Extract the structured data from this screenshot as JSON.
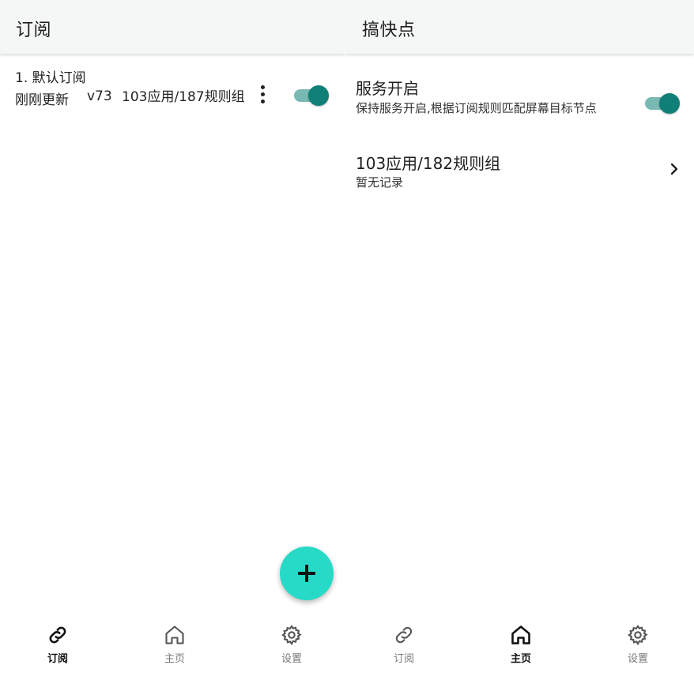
{
  "left": {
    "title": "订阅",
    "subscription": {
      "name": "1. 默认订阅",
      "updated": "刚刚更新",
      "version": "v73",
      "stats": "103应用/187规则组",
      "enabled": true
    },
    "fab_icon": "plus-icon",
    "nav": [
      {
        "label": "订阅",
        "icon": "link-icon",
        "active": true
      },
      {
        "label": "主页",
        "icon": "home-icon",
        "active": false
      },
      {
        "label": "设置",
        "icon": "gear-icon",
        "active": false
      }
    ]
  },
  "right": {
    "title": "搞快点",
    "service": {
      "title": "服务开启",
      "description": "保持服务开启,根据订阅规则匹配屏幕目标节点",
      "enabled": true
    },
    "rules": {
      "title": "103应用/182规则组",
      "subtitle": "暂无记录"
    },
    "nav": [
      {
        "label": "订阅",
        "icon": "link-icon",
        "active": false
      },
      {
        "label": "主页",
        "icon": "home-icon",
        "active": true
      },
      {
        "label": "设置",
        "icon": "gear-icon",
        "active": false
      }
    ]
  },
  "colors": {
    "accent": "#0f7f78",
    "switch_track": "#7ab9b3",
    "fab": "#27d9c7",
    "appbar": "#f5f6f6"
  }
}
